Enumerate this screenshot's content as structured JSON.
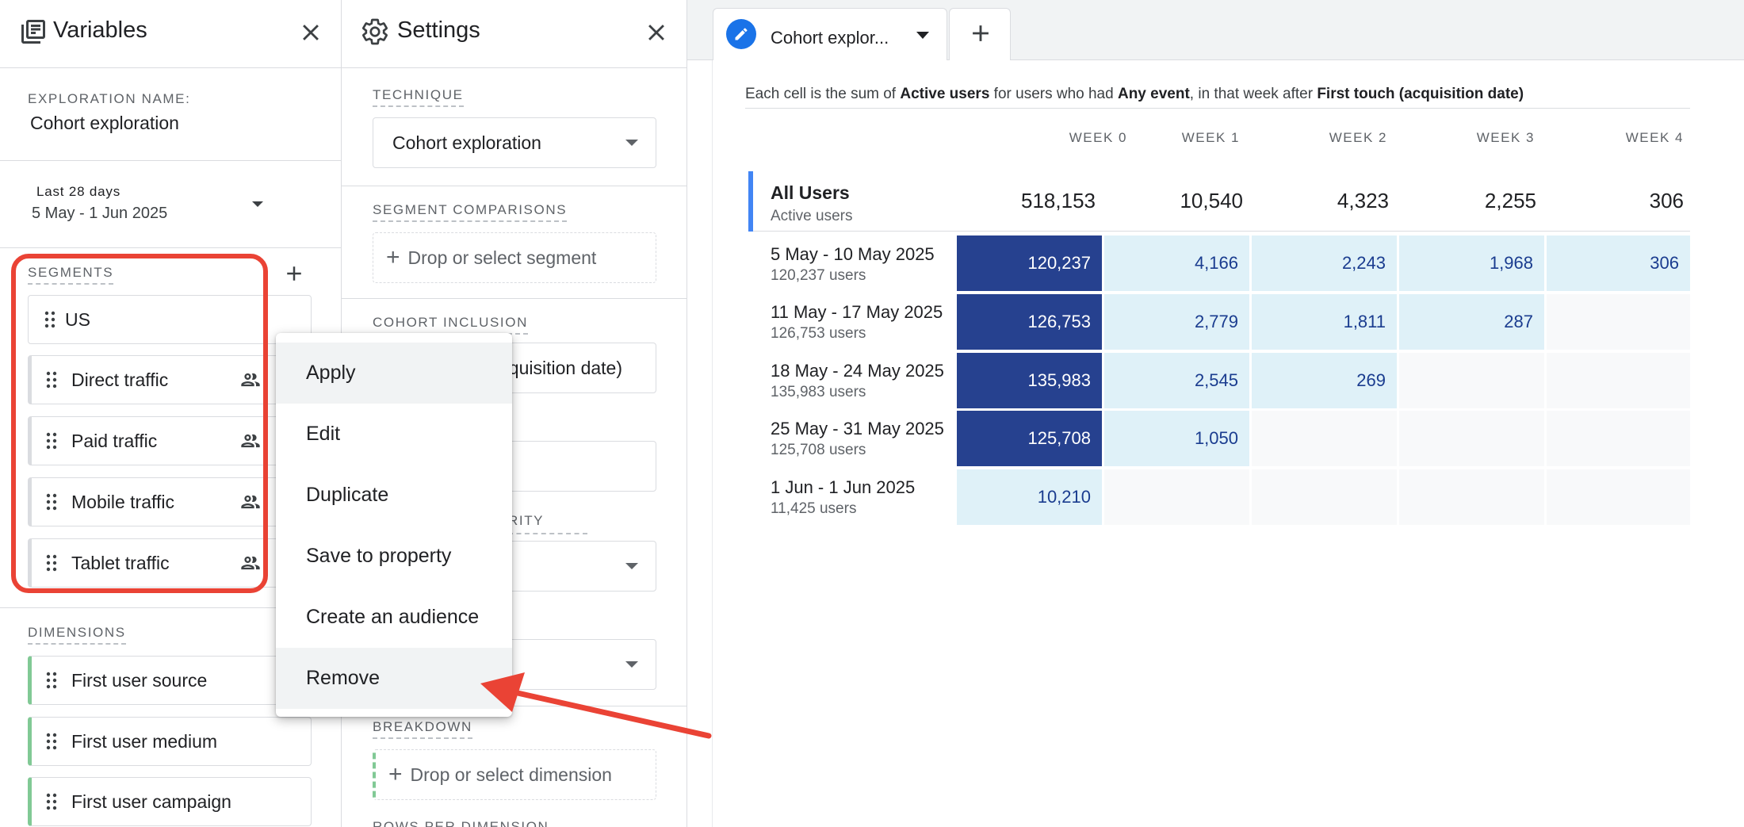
{
  "variables_panel": {
    "title": "Variables",
    "exploration_name_label": "EXPLORATION NAME:",
    "exploration_name": "Cohort exploration",
    "date_badge": "Last 28 days",
    "date_range": "5 May - 1 Jun 2025",
    "segments_label": "SEGMENTS",
    "segments": [
      {
        "label": "US"
      },
      {
        "label": "Direct traffic"
      },
      {
        "label": "Paid traffic"
      },
      {
        "label": "Mobile traffic"
      },
      {
        "label": "Tablet traffic"
      }
    ],
    "dimensions_label": "DIMENSIONS",
    "dimensions": [
      {
        "label": "First user source"
      },
      {
        "label": "First user medium"
      },
      {
        "label": "First user campaign"
      }
    ]
  },
  "settings_panel": {
    "title": "Settings",
    "technique_label": "TECHNIQUE",
    "technique_value": "Cohort exploration",
    "segment_comparisons_label": "SEGMENT COMPARISONS",
    "segment_drop": "Drop or select segment",
    "cohort_inclusion_label": "COHORT INCLUSION",
    "cohort_inclusion_value_partial": "quisition date)",
    "granularity_label_partial": "RITY",
    "breakdown_label": "BREAKDOWN",
    "breakdown_drop": "Drop or select dimension",
    "rows_label_partial": "ROWS PER DIMENSION"
  },
  "context_menu": {
    "items": [
      "Apply",
      "Edit",
      "Duplicate",
      "Save to property",
      "Create an audience",
      "Remove"
    ]
  },
  "tabs": {
    "active_label": "Cohort explor..."
  },
  "cohort": {
    "description": {
      "p1": "Each cell is the sum of ",
      "metric": "Active users",
      "p2": " for users who had ",
      "event": "Any event",
      "p3": ", in that week after ",
      "inclusion": "First touch (acquisition date)"
    },
    "weeks": [
      "WEEK 0",
      "WEEK 1",
      "WEEK 2",
      "WEEK 3",
      "WEEK 4"
    ],
    "total": {
      "name": "All Users",
      "sub": "Active users",
      "values": [
        "518,153",
        "10,540",
        "4,323",
        "2,255",
        "306"
      ]
    },
    "rows": [
      {
        "date": "5 May - 10 May 2025",
        "users": "120,237 users",
        "cells": [
          "120,237",
          "4,166",
          "2,243",
          "1,968",
          "306"
        ]
      },
      {
        "date": "11 May - 17 May 2025",
        "users": "126,753 users",
        "cells": [
          "126,753",
          "2,779",
          "1,811",
          "287",
          ""
        ]
      },
      {
        "date": "18 May - 24 May 2025",
        "users": "135,983 users",
        "cells": [
          "135,983",
          "2,545",
          "269",
          "",
          ""
        ]
      },
      {
        "date": "25 May - 31 May 2025",
        "users": "125,708 users",
        "cells": [
          "125,708",
          "1,050",
          "",
          "",
          ""
        ]
      },
      {
        "date": "1 Jun - 1 Jun 2025",
        "users": "11,425 users",
        "cells": [
          "10,210",
          "",
          "",
          "",
          ""
        ]
      }
    ]
  },
  "colors": {
    "accent_blue": "#1a73e8",
    "cohort_dark": "#26418f",
    "cohort_light": "#dff1f8",
    "highlight_red": "#ea4335",
    "dimension_green": "#81c995"
  }
}
